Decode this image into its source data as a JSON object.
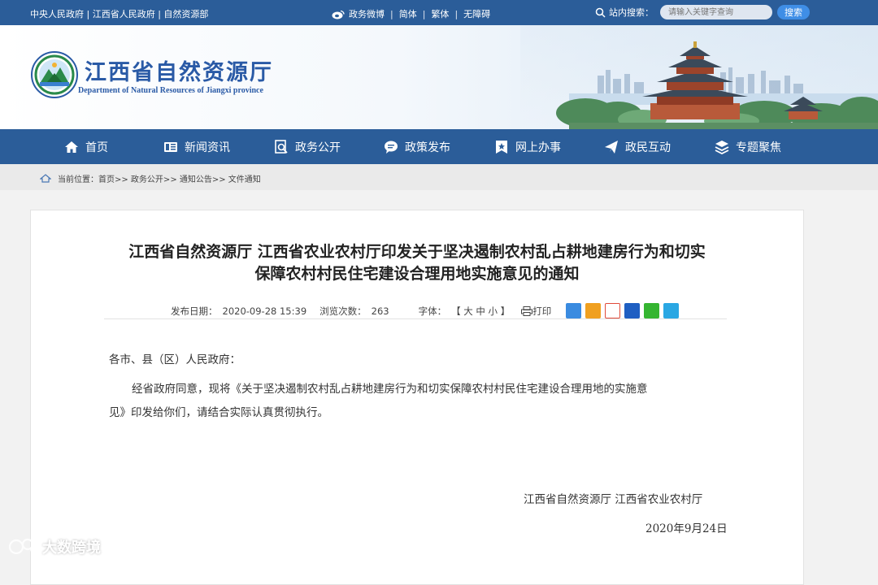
{
  "topbar": {
    "links": "中央人民政府 | 江西省人民政府 | 自然资源部",
    "weibo": "政务微博",
    "simplified": "简体",
    "traditional": "繁体",
    "accessibility": "无障碍",
    "search_label": "站内搜索：",
    "search_placeholder": "请输入关键字查询",
    "search_button": "搜索"
  },
  "header": {
    "title": "江西省自然资源厅",
    "subtitle": "Department of Natural Resources of Jiangxi province"
  },
  "nav": {
    "items": [
      {
        "label": "首页",
        "icon": "home-icon"
      },
      {
        "label": "新闻资讯",
        "icon": "news-icon"
      },
      {
        "label": "政务公开",
        "icon": "document-search-icon"
      },
      {
        "label": "政策发布",
        "icon": "chat-bubble-icon"
      },
      {
        "label": "网上办事",
        "icon": "bookmark-star-icon"
      },
      {
        "label": "政民互动",
        "icon": "paper-plane-icon"
      },
      {
        "label": "专题聚焦",
        "icon": "layers-icon"
      }
    ]
  },
  "breadcrumb": {
    "text": "当前位置：首页>> 政务公开>> 通知公告>> 文件通知"
  },
  "article": {
    "title_line1": "江西省自然资源厅 江西省农业农村厅印发关于坚决遏制农村乱占耕地建房行为和切实",
    "title_line2": "保障农村村民住宅建设合理用地实施意见的通知",
    "date_label": "发布日期：",
    "date_value": "2020-09-28 15:39",
    "views_label": "浏览次数：",
    "views_value": "263",
    "font_label": "字体：",
    "font_options": "【 大 中 小 】",
    "print_label": "打印",
    "salutation": "各市、县（区）人民政府：",
    "para_line1": "经省政府同意，现将《关于坚决遏制农村乱占耕地建房行为和切实保障农村村民住宅建设合理用地的实施意",
    "para_line2": "见》印发给你们，请结合实际认真贯彻执行。",
    "signature": "江西省自然资源厅  江西省农业农村厅",
    "sign_date": "2020年9月24日"
  },
  "watermark": {
    "text": "大数跨境"
  },
  "colors": {
    "brand_blue": "#2b5d99",
    "title_blue": "#2a5aa6",
    "search_button": "#3f8ee6"
  }
}
